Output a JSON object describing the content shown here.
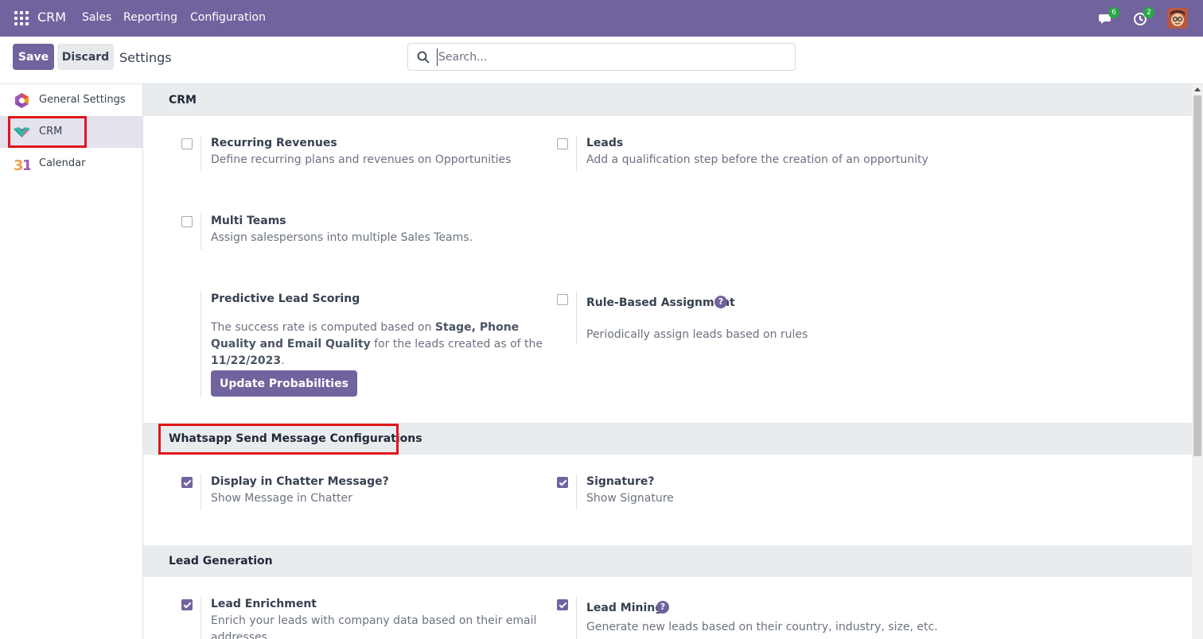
{
  "navbar": {
    "brand": "CRM",
    "menu": [
      "Sales",
      "Reporting",
      "Configuration"
    ],
    "messages_count": "6",
    "activities_count": "2",
    "icons": {
      "apps": "apps-grid-icon",
      "messages": "chat-icon",
      "activities": "clock-icon"
    }
  },
  "control_panel": {
    "save_label": "Save",
    "discard_label": "Discard",
    "title": "Settings",
    "search_placeholder": "Search..."
  },
  "sidebar": {
    "items": [
      {
        "label": "General Settings",
        "icon": "general-settings-icon",
        "active": false
      },
      {
        "label": "CRM",
        "icon": "crm-handshake-icon",
        "active": true
      },
      {
        "label": "Calendar",
        "icon": "calendar-31-icon",
        "active": false
      }
    ]
  },
  "sections": {
    "crm": {
      "title": "CRM",
      "recurring": {
        "title": "Recurring Revenues",
        "desc": "Define recurring plans and revenues on Opportunities",
        "checked": false
      },
      "leads": {
        "title": "Leads",
        "desc": "Add a qualification step before the creation of an opportunity",
        "checked": false
      },
      "multi_teams": {
        "title": "Multi Teams",
        "desc": "Assign salespersons into multiple Sales Teams.",
        "checked": false
      },
      "pls": {
        "title": "Predictive Lead Scoring",
        "text_1": "The success rate is computed based on ",
        "fields": "Stage, Phone Quality and Email Quality",
        "text_2": " for the leads created as of the ",
        "date": "11/22/2023",
        "text_3": ".",
        "button": "Update Probabilities"
      },
      "rule_based": {
        "title": "Rule-Based Assignment",
        "desc": "Periodically assign leads based on rules",
        "checked": false
      }
    },
    "whatsapp": {
      "title": "Whatsapp Send Message Configurations",
      "chatter": {
        "title": "Display in Chatter Message?",
        "desc": "Show Message in Chatter",
        "checked": true
      },
      "signature": {
        "title": "Signature?",
        "desc": "Show Signature",
        "checked": true
      }
    },
    "lead_gen": {
      "title": "Lead Generation",
      "enrichment": {
        "title": "Lead Enrichment",
        "desc_1": "Enrich your leads with company data based on their email",
        "desc_2": "addresses",
        "checked": true
      },
      "mining": {
        "title": "Lead Mining",
        "desc": "Generate new leads based on their country, industry, size, etc.",
        "checked": true
      }
    }
  },
  "colors": {
    "brand": "#71639e",
    "badge": "#28a745",
    "highlight": "#e0161a"
  }
}
